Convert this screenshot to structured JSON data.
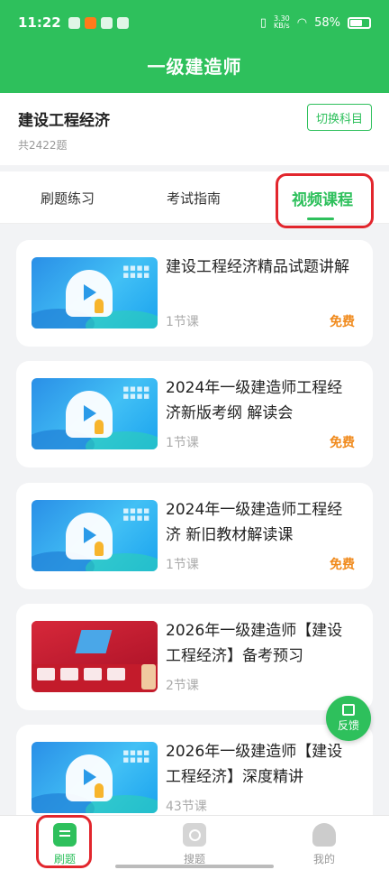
{
  "status_bar": {
    "time": "11:22",
    "net_speed_value": "3.30",
    "net_speed_unit": "KB/s",
    "battery_percent": "58%"
  },
  "app_bar": {
    "title": "一级建造师"
  },
  "subject": {
    "name": "建设工程经济",
    "count": "共2422题",
    "switch_label": "切换科目"
  },
  "tabs": [
    {
      "label": "刷题练习",
      "active": false
    },
    {
      "label": "考试指南",
      "active": false
    },
    {
      "label": "视频课程",
      "active": true
    }
  ],
  "courses": [
    {
      "title": "建设工程经济精品试题讲解",
      "lessons": "1节课",
      "price": "免费",
      "thumb": "blue"
    },
    {
      "title": "2024年一级建造师工程经济新版考纲 解读会",
      "lessons": "1节课",
      "price": "免费",
      "thumb": "blue"
    },
    {
      "title": "2024年一级建造师工程经济 新旧教材解读课",
      "lessons": "1节课",
      "price": "免费",
      "thumb": "blue"
    },
    {
      "title": "2026年一级建造师【建设工程经济】备考预习",
      "lessons": "2节课",
      "price": "",
      "thumb": "red"
    },
    {
      "title": "2026年一级建造师【建设工程经济】深度精讲",
      "lessons": "43节课",
      "price": "",
      "thumb": "blue"
    }
  ],
  "feedback": {
    "label": "反馈"
  },
  "bottom_nav": [
    {
      "label": "刷题",
      "icon": "document-icon",
      "active": true
    },
    {
      "label": "搜题",
      "icon": "search-camera-icon",
      "active": false
    },
    {
      "label": "我的",
      "icon": "person-icon",
      "active": false
    }
  ],
  "colors": {
    "brand_green": "#2ec05c",
    "price_orange": "#f08a1c",
    "annotation_red": "#e2262d"
  }
}
